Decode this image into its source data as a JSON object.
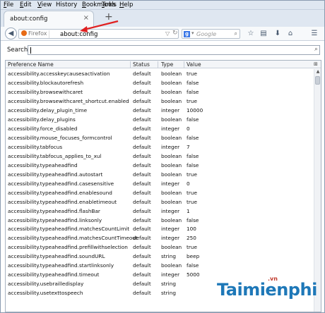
{
  "menubar": [
    {
      "label": "File",
      "accel": "F",
      "rest": "ile"
    },
    {
      "label": "Edit",
      "accel": "E",
      "rest": "dit"
    },
    {
      "label": "View",
      "accel": "V",
      "rest": "iew"
    },
    {
      "label": "History",
      "accel": "",
      "rest": "History",
      "under": "S"
    },
    {
      "label": "Bookmarks",
      "accel": "B",
      "rest": "ookmarks"
    },
    {
      "label": "Tools",
      "accel": "T",
      "rest": "ools"
    },
    {
      "label": "Help",
      "accel": "H",
      "rest": "elp"
    }
  ],
  "tab": {
    "title": "about:config",
    "close": "×"
  },
  "new_tab": "+",
  "urlbar": {
    "identity": "Firefox",
    "url": "about:config"
  },
  "searchbar": {
    "placeholder": "Google",
    "engine": "g"
  },
  "cfg": {
    "search_label": "Search:"
  },
  "columns": {
    "name": "Preference Name",
    "status": "Status",
    "type": "Type",
    "value": "Value"
  },
  "rows": [
    {
      "name": "accessibility.accesskeycausesactivation",
      "status": "default",
      "type": "boolean",
      "value": "true"
    },
    {
      "name": "accessibility.blockautorefresh",
      "status": "default",
      "type": "boolean",
      "value": "false"
    },
    {
      "name": "accessibility.browsewithcaret",
      "status": "default",
      "type": "boolean",
      "value": "false"
    },
    {
      "name": "accessibility.browsewithcaret_shortcut.enabled",
      "status": "default",
      "type": "boolean",
      "value": "true"
    },
    {
      "name": "accessibility.delay_plugin_time",
      "status": "default",
      "type": "integer",
      "value": "10000"
    },
    {
      "name": "accessibility.delay_plugins",
      "status": "default",
      "type": "boolean",
      "value": "false"
    },
    {
      "name": "accessibility.force_disabled",
      "status": "default",
      "type": "integer",
      "value": "0"
    },
    {
      "name": "accessibility.mouse_focuses_formcontrol",
      "status": "default",
      "type": "boolean",
      "value": "false"
    },
    {
      "name": "accessibility.tabfocus",
      "status": "default",
      "type": "integer",
      "value": "7"
    },
    {
      "name": "accessibility.tabfocus_applies_to_xul",
      "status": "default",
      "type": "boolean",
      "value": "false"
    },
    {
      "name": "accessibility.typeaheadfind",
      "status": "default",
      "type": "boolean",
      "value": "false"
    },
    {
      "name": "accessibility.typeaheadfind.autostart",
      "status": "default",
      "type": "boolean",
      "value": "true"
    },
    {
      "name": "accessibility.typeaheadfind.casesensitive",
      "status": "default",
      "type": "integer",
      "value": "0"
    },
    {
      "name": "accessibility.typeaheadfind.enablesound",
      "status": "default",
      "type": "boolean",
      "value": "true"
    },
    {
      "name": "accessibility.typeaheadfind.enabletimeout",
      "status": "default",
      "type": "boolean",
      "value": "true"
    },
    {
      "name": "accessibility.typeaheadfind.flashBar",
      "status": "default",
      "type": "integer",
      "value": "1"
    },
    {
      "name": "accessibility.typeaheadfind.linksonly",
      "status": "default",
      "type": "boolean",
      "value": "false"
    },
    {
      "name": "accessibility.typeaheadfind.matchesCountLimit",
      "status": "default",
      "type": "integer",
      "value": "100"
    },
    {
      "name": "accessibility.typeaheadfind.matchesCountTimeout",
      "status": "default",
      "type": "integer",
      "value": "250"
    },
    {
      "name": "accessibility.typeaheadfind.prefillwithselection",
      "status": "default",
      "type": "boolean",
      "value": "true"
    },
    {
      "name": "accessibility.typeaheadfind.soundURL",
      "status": "default",
      "type": "string",
      "value": "beep"
    },
    {
      "name": "accessibility.typeaheadfind.startlinksonly",
      "status": "default",
      "type": "boolean",
      "value": "false"
    },
    {
      "name": "accessibility.typeaheadfind.timeout",
      "status": "default",
      "type": "integer",
      "value": "5000"
    },
    {
      "name": "accessibility.usebrailledisplay",
      "status": "default",
      "type": "string",
      "value": ""
    },
    {
      "name": "accessibility.usetexttospeech",
      "status": "default",
      "type": "string",
      "value": ""
    }
  ],
  "watermark": {
    "brand": "Taimienphi",
    "tld": ".vn"
  },
  "colors": {
    "accent": "#1e78b8",
    "annotation": "#e02020",
    "menubar_bg": "#dfe7f1"
  }
}
